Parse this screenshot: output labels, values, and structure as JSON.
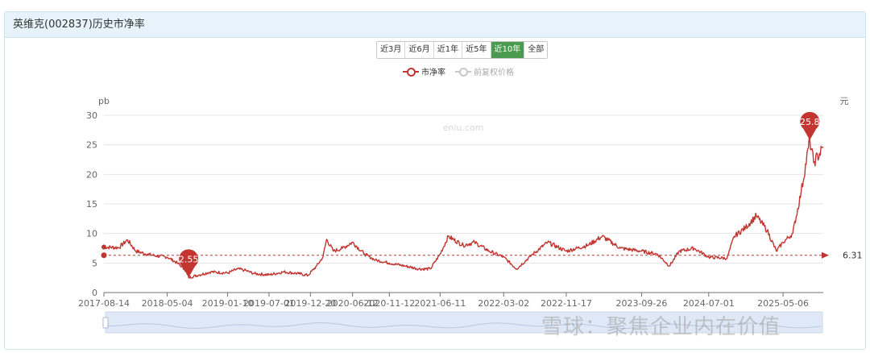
{
  "header": {
    "title": "英维克(002837)历史市净率"
  },
  "range_buttons": [
    "近3月",
    "近6月",
    "近1年",
    "近5年",
    "近10年",
    "全部"
  ],
  "active_range": "近10年",
  "legend": {
    "pb": "市净率",
    "price": "前复权价格"
  },
  "watermark_site": "eniu.com",
  "watermark_brand": "雪球：聚焦企业内在价值",
  "colors": {
    "pb_line": "#c23531",
    "price_line": "#c8c8c8",
    "active_button": "#4a9b4f",
    "header_bg": "#e6f3fb"
  },
  "chart_data": {
    "type": "line",
    "title": "英维克(002837)历史市净率",
    "ylabel_left": "pb",
    "ylabel_right": "元",
    "ylim": [
      0,
      30
    ],
    "yticks": [
      0,
      5,
      10,
      15,
      20,
      25,
      30
    ],
    "x_range": [
      "2017-08-14",
      "2025-10-20"
    ],
    "xtick_labels": [
      "2017-08-14",
      "2018-05-04",
      "2019-01-10",
      "2019-07-01",
      "2019-12-20",
      "2020-06-12",
      "2020-11-12",
      "2021-06-11",
      "2022-03-02",
      "2022-11-17",
      "2023-09-26",
      "2024-07-01",
      "2025-05-06"
    ],
    "grid": true,
    "series": [
      {
        "name": "市净率",
        "points": [
          [
            "2017-08-14",
            7.7
          ],
          [
            "2017-10-15",
            7.6
          ],
          [
            "2017-11-20",
            8.9
          ],
          [
            "2017-12-25",
            7.0
          ],
          [
            "2018-02-10",
            6.5
          ],
          [
            "2018-03-20",
            6.2
          ],
          [
            "2018-05-04",
            6.0
          ],
          [
            "2018-06-15",
            5.0
          ],
          [
            "2018-07-15",
            4.0
          ],
          [
            "2018-08-01",
            2.55
          ],
          [
            "2018-09-15",
            3.0
          ],
          [
            "2018-11-01",
            3.5
          ],
          [
            "2019-01-10",
            3.3
          ],
          [
            "2019-02-20",
            4.0
          ],
          [
            "2019-03-20",
            3.8
          ],
          [
            "2019-05-01",
            3.2
          ],
          [
            "2019-07-01",
            3.0
          ],
          [
            "2019-09-01",
            3.5
          ],
          [
            "2019-11-01",
            3.2
          ],
          [
            "2019-12-10",
            2.9
          ],
          [
            "2020-01-15",
            4.5
          ],
          [
            "2020-02-10",
            6.0
          ],
          [
            "2020-02-25",
            9.0
          ],
          [
            "2020-03-25",
            7.0
          ],
          [
            "2020-05-01",
            7.5
          ],
          [
            "2020-06-12",
            8.5
          ],
          [
            "2020-08-01",
            6.5
          ],
          [
            "2020-09-15",
            5.5
          ],
          [
            "2020-11-12",
            5.0
          ],
          [
            "2021-01-15",
            4.5
          ],
          [
            "2021-03-15",
            4.0
          ],
          [
            "2021-05-01",
            4.0
          ],
          [
            "2021-06-11",
            6.5
          ],
          [
            "2021-07-15",
            9.5
          ],
          [
            "2021-09-15",
            8.0
          ],
          [
            "2021-11-01",
            8.5
          ],
          [
            "2022-01-01",
            7.0
          ],
          [
            "2022-03-02",
            6.0
          ],
          [
            "2022-04-25",
            4.0
          ],
          [
            "2022-07-01",
            6.5
          ],
          [
            "2022-09-01",
            8.5
          ],
          [
            "2022-11-17",
            7.0
          ],
          [
            "2023-02-15",
            8.0
          ],
          [
            "2023-04-15",
            9.5
          ],
          [
            "2023-07-01",
            7.5
          ],
          [
            "2023-09-26",
            7.0
          ],
          [
            "2023-12-01",
            6.5
          ],
          [
            "2024-01-20",
            4.5
          ],
          [
            "2024-03-01",
            7.0
          ],
          [
            "2024-05-01",
            7.5
          ],
          [
            "2024-07-01",
            6.0
          ],
          [
            "2024-09-15",
            5.8
          ],
          [
            "2024-10-15",
            9.5
          ],
          [
            "2024-12-01",
            11.0
          ],
          [
            "2025-01-15",
            13.0
          ],
          [
            "2025-03-01",
            10.5
          ],
          [
            "2025-04-08",
            7.0
          ],
          [
            "2025-05-06",
            8.5
          ],
          [
            "2025-06-15",
            10.0
          ],
          [
            "2025-07-20",
            17.0
          ],
          [
            "2025-08-25",
            25.8
          ],
          [
            "2025-09-10",
            22.0
          ],
          [
            "2025-10-20",
            24.5
          ]
        ]
      }
    ],
    "markers": {
      "min": {
        "value": 2.55,
        "label": "2.55",
        "date": "2018-08-01"
      },
      "max": {
        "value": 25.8,
        "label": "25.8",
        "date": "2025-08-25"
      },
      "current": {
        "value": 6.31,
        "label": "6.31"
      }
    }
  }
}
